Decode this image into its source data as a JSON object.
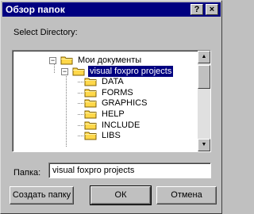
{
  "window": {
    "title": "Обзор папок",
    "help_label": "?",
    "close_label": "×"
  },
  "prompt": "Select Directory:",
  "tree": {
    "items": [
      {
        "label": "Мои документы",
        "depth": 0,
        "expanded": true,
        "selected": false
      },
      {
        "label": "visual foxpro projects",
        "depth": 1,
        "expanded": true,
        "selected": true
      },
      {
        "label": "DATA",
        "depth": 2,
        "expanded": false,
        "selected": false
      },
      {
        "label": "FORMS",
        "depth": 2,
        "expanded": false,
        "selected": false
      },
      {
        "label": "GRAPHICS",
        "depth": 2,
        "expanded": false,
        "selected": false
      },
      {
        "label": "HELP",
        "depth": 2,
        "expanded": false,
        "selected": false
      },
      {
        "label": "INCLUDE",
        "depth": 2,
        "expanded": false,
        "selected": false
      },
      {
        "label": "LIBS",
        "depth": 2,
        "expanded": false,
        "selected": false
      }
    ],
    "scroll_up_glyph": "▲",
    "scroll_down_glyph": "▼"
  },
  "folder": {
    "label": "Папка:",
    "value": "visual foxpro projects"
  },
  "buttons": {
    "new_folder": "Создать папку",
    "ok": "ОК",
    "cancel": "Отмена"
  },
  "colors": {
    "titlebar": "#000080",
    "face": "#c0c0c0",
    "folder": "#ffd84a",
    "selection": "#000080"
  }
}
